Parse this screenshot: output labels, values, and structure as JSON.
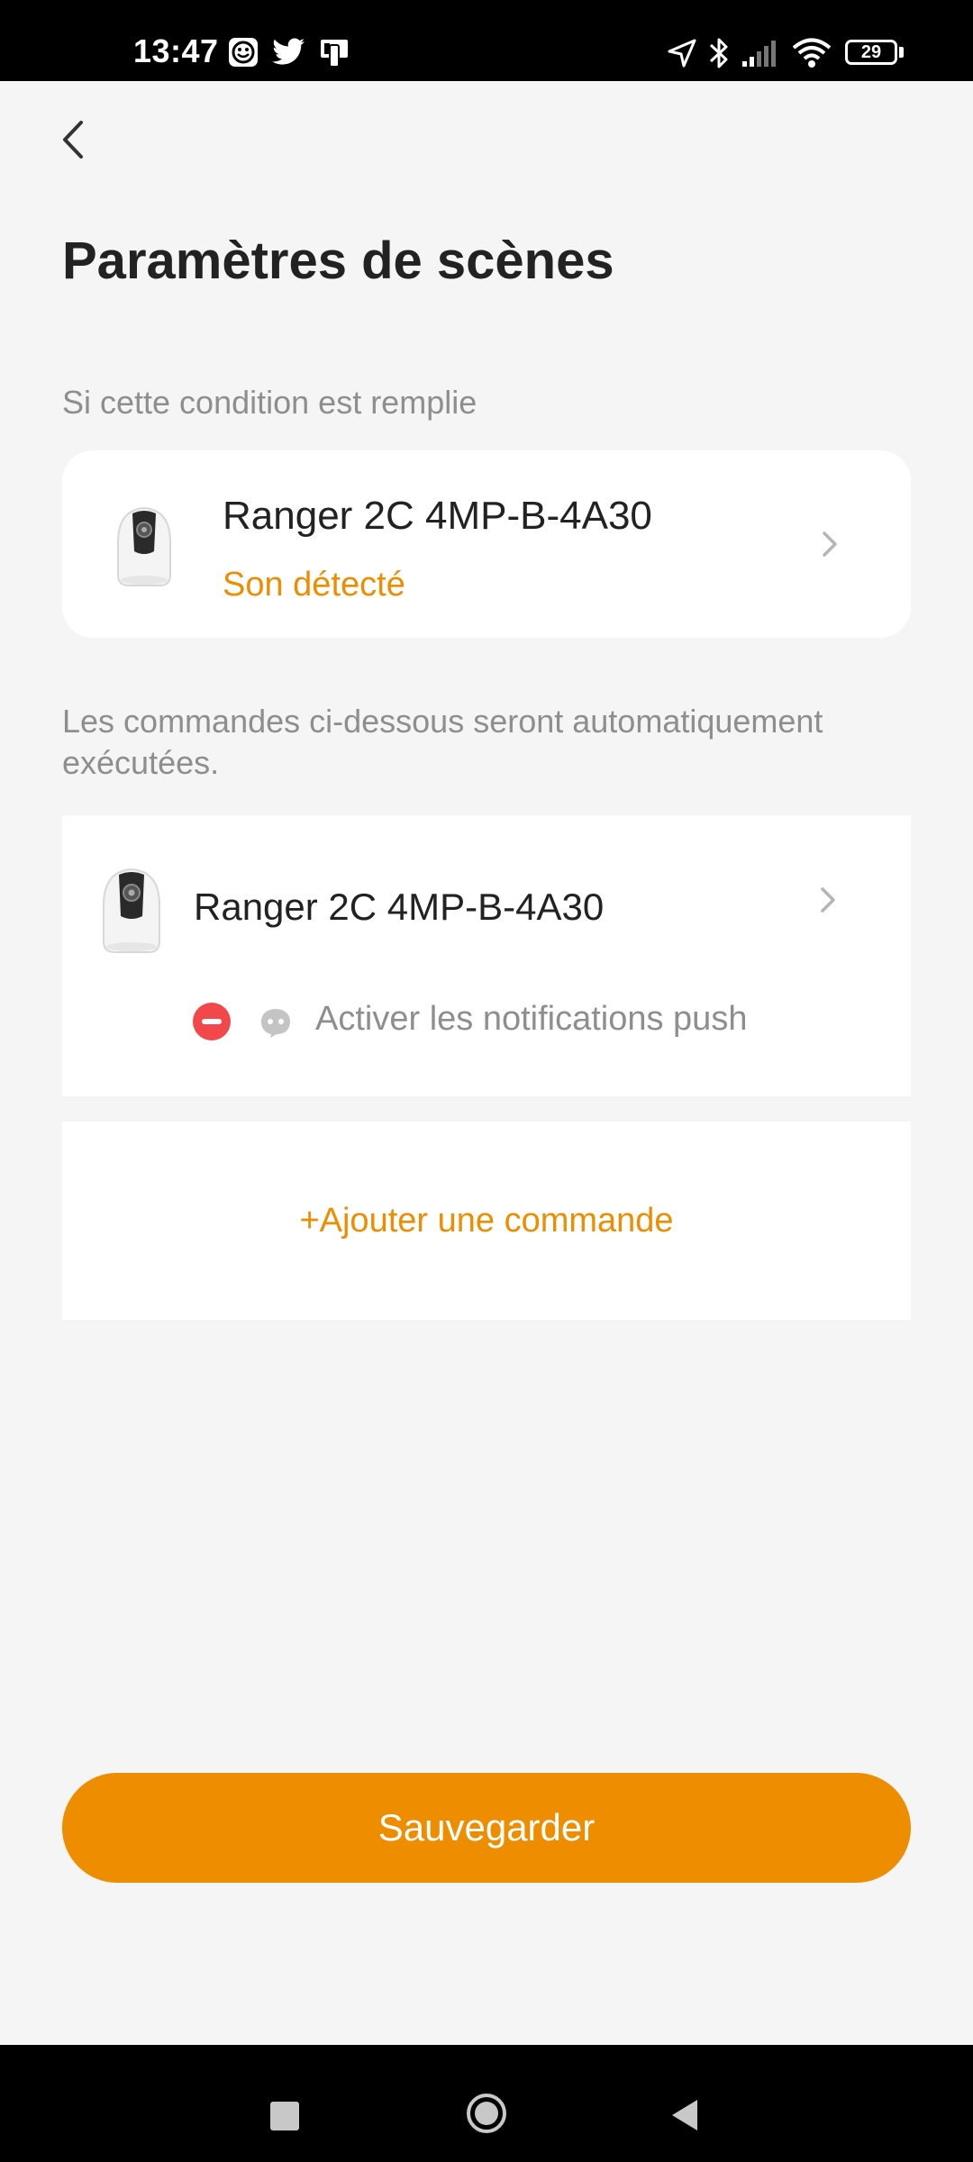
{
  "status_bar": {
    "time": "13:47",
    "battery": "29",
    "icons": [
      "face-icon",
      "twitter-icon",
      "device-icon",
      "location-icon",
      "bluetooth-icon",
      "signal-icon",
      "wifi-icon",
      "battery-icon"
    ]
  },
  "header": {
    "back_icon": "chevron-left-icon",
    "title": "Paramètres de scènes"
  },
  "condition_section": {
    "label": "Si cette condition est remplie",
    "device_name": "Ranger 2C 4MP-B-4A30",
    "status": "Son détecté"
  },
  "commands_section": {
    "label_line1": "Les commandes ci-dessous seront automatiquement",
    "label_line2": "exécutées.",
    "device_name": "Ranger 2C 4MP-B-4A30",
    "action": "Activer les notifications push",
    "add_label": "+Ajouter une commande"
  },
  "save_label": "Sauvegarder",
  "colors": {
    "accent": "#ef8d00",
    "remove": "#f2484b",
    "background": "#f5f5f5"
  },
  "nav_bar": {
    "icons": [
      "recents-icon",
      "home-icon",
      "back-icon"
    ]
  }
}
